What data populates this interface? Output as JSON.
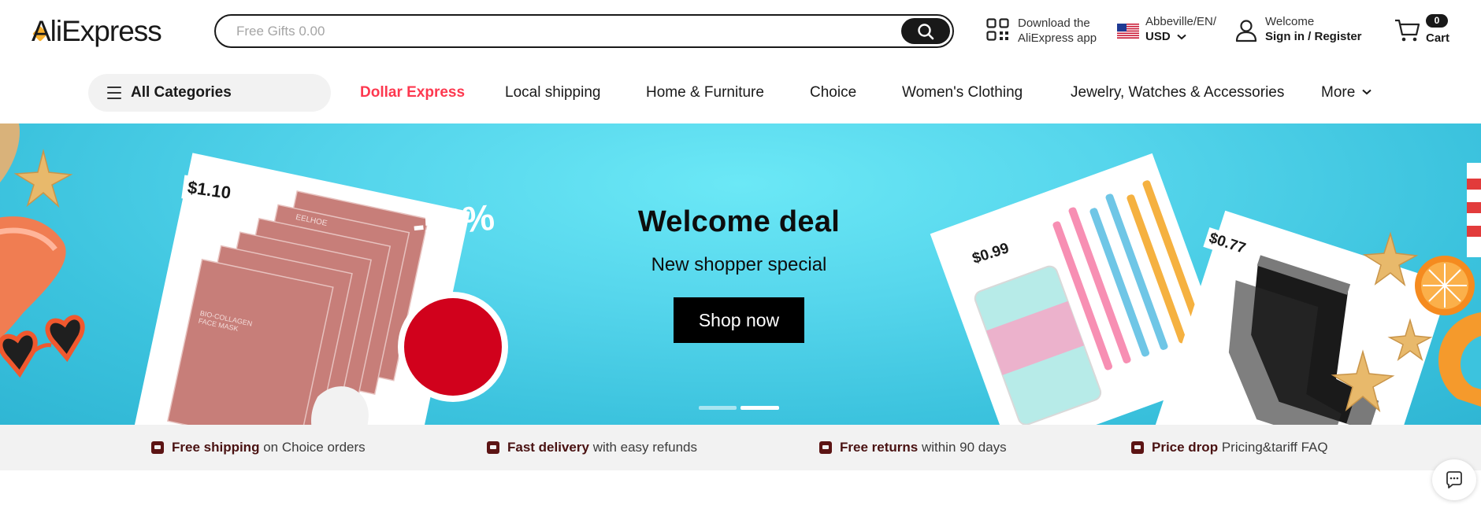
{
  "header": {
    "logo_text": "AliExpress",
    "search": {
      "placeholder": "Free Gifts 0.00"
    },
    "app_download": {
      "line1": "Download the",
      "line2": "AliExpress app"
    },
    "locale": {
      "region": "Abbeville/EN/",
      "currency": "USD"
    },
    "account": {
      "greeting": "Welcome",
      "action": "Sign in / Register"
    },
    "cart": {
      "count": "0",
      "label": "Cart"
    }
  },
  "nav": {
    "all_categories": "All Categories",
    "links": [
      "Dollar Express",
      "Local shipping",
      "Home & Furniture",
      "Choice",
      "Women's Clothing",
      "Jewelry, Watches & Accessories",
      "More"
    ]
  },
  "hero": {
    "title": "Welcome deal",
    "subtitle": "New shopper special",
    "cta": "Shop now",
    "discount_badge": "-53%",
    "prices": [
      "$1.10",
      "$0.99",
      "$0.77"
    ],
    "mask_brand": "EELHOE",
    "mask_text": "BIO-COLLAGEN FACE MASK",
    "carousel_active_index": 1,
    "carousel_count": 2
  },
  "benefits": [
    {
      "bold": "Free shipping",
      "rest": "on Choice orders"
    },
    {
      "bold": "Fast delivery",
      "rest": "with easy refunds"
    },
    {
      "bold": "Free returns",
      "rest": "within 90 days"
    },
    {
      "bold": "Price drop",
      "rest": "Pricing&tariff FAQ"
    }
  ],
  "colors": {
    "brand_red": "#fd384f",
    "badge_red": "#d1011c",
    "hero_cyan": "#56d6ec",
    "benefit_brown": "#5c1414"
  },
  "icons": [
    "search-icon",
    "qr-code-icon",
    "us-flag-icon",
    "chevron-down-icon",
    "user-icon",
    "cart-icon",
    "menu-icon",
    "chat-icon"
  ]
}
